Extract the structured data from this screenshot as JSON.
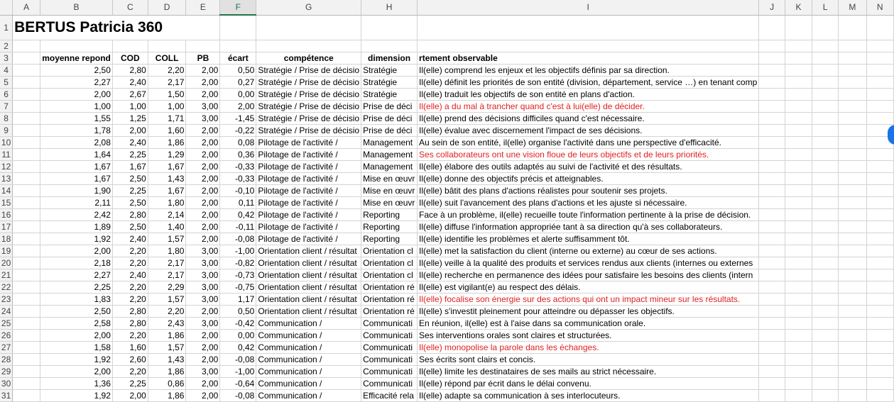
{
  "columns": [
    "A",
    "B",
    "C",
    "D",
    "E",
    "F",
    "G",
    "H",
    "I",
    "J",
    "K",
    "L",
    "M",
    "N"
  ],
  "selected_column": "F",
  "title": "BERTUS  Patricia 360",
  "headers": {
    "b": "moyenne repond",
    "c": "COD",
    "d": "COLL",
    "e": "PB",
    "f": "écart",
    "g": "compétence",
    "h": "dimension",
    "i": "rtement observable"
  },
  "rows": [
    {
      "n": "4",
      "b": "2,50",
      "c": "2,80",
      "d": "2,20",
      "e": "2,00",
      "f": "0,50",
      "g": "Stratégie / Prise de décisio",
      "h": "Stratégie",
      "i": "Il(elle) comprend les enjeux et les objectifs définis par sa direction.",
      "red": false
    },
    {
      "n": "5",
      "b": "2,27",
      "c": "2,40",
      "d": "2,17",
      "e": "2,00",
      "f": "0,27",
      "g": "Stratégie / Prise de décisio",
      "h": "Stratégie",
      "i": "Il(elle) définit les priorités de son entité (division, département, service …) en tenant comp",
      "red": false
    },
    {
      "n": "6",
      "b": "2,00",
      "c": "2,67",
      "d": "1,50",
      "e": "2,00",
      "f": "0,00",
      "g": "Stratégie / Prise de décisio",
      "h": "Stratégie",
      "i": "Il(elle) traduit les objectifs de son entité en plans d'action.",
      "red": false
    },
    {
      "n": "7",
      "b": "1,00",
      "c": "1,00",
      "d": "1,00",
      "e": "3,00",
      "f": "2,00",
      "g": "Stratégie / Prise de décisio",
      "h": "Prise de déci",
      "i": "Il(elle) a du mal à trancher quand c'est à lui(elle) de décider.",
      "red": true
    },
    {
      "n": "8",
      "b": "1,55",
      "c": "1,25",
      "d": "1,71",
      "e": "3,00",
      "f": "-1,45",
      "g": "Stratégie / Prise de décisio",
      "h": "Prise de déci",
      "i": "Il(elle) prend des décisions difficiles quand c'est nécessaire.",
      "red": false
    },
    {
      "n": "9",
      "b": "1,78",
      "c": "2,00",
      "d": "1,60",
      "e": "2,00",
      "f": "-0,22",
      "g": "Stratégie / Prise de décisio",
      "h": "Prise de déci",
      "i": "Il(elle) évalue avec discernement l'impact de ses décisions.",
      "red": false
    },
    {
      "n": "10",
      "b": "2,08",
      "c": "2,40",
      "d": "1,86",
      "e": "2,00",
      "f": "0,08",
      "g": "Pilotage de l'activité /",
      "h": "Management",
      "i": "Au sein de son entité, il(elle) organise l'activité dans une perspective d'efficacité.",
      "red": false
    },
    {
      "n": "11",
      "b": "1,64",
      "c": "2,25",
      "d": "1,29",
      "e": "2,00",
      "f": "0,36",
      "g": "Pilotage de l'activité /",
      "h": "Management",
      "i": "Ses collaborateurs ont une vision floue de leurs objectifs et de leurs priorités.",
      "red": true
    },
    {
      "n": "12",
      "b": "1,67",
      "c": "1,67",
      "d": "1,67",
      "e": "2,00",
      "f": "-0,33",
      "g": "Pilotage de l'activité /",
      "h": "Management",
      "i": "Il(elle) élabore des outils adaptés au suivi de l'activité et des résultats.",
      "red": false
    },
    {
      "n": "13",
      "b": "1,67",
      "c": "2,50",
      "d": "1,43",
      "e": "2,00",
      "f": "-0,33",
      "g": "Pilotage de l'activité /",
      "h": "Mise en œuvr",
      "i": "Il(elle) donne des objectifs précis et atteignables.",
      "red": false
    },
    {
      "n": "14",
      "b": "1,90",
      "c": "2,25",
      "d": "1,67",
      "e": "2,00",
      "f": "-0,10",
      "g": "Pilotage de l'activité /",
      "h": "Mise en œuvr",
      "i": "Il(elle) bâtit des plans d'actions réalistes pour soutenir ses projets.",
      "red": false
    },
    {
      "n": "15",
      "b": "2,11",
      "c": "2,50",
      "d": "1,80",
      "e": "2,00",
      "f": "0,11",
      "g": "Pilotage de l'activité /",
      "h": "Mise en œuvr",
      "i": "Il(elle) suit l'avancement des plans d'actions et les ajuste si nécessaire.",
      "red": false
    },
    {
      "n": "16",
      "b": "2,42",
      "c": "2,80",
      "d": "2,14",
      "e": "2,00",
      "f": "0,42",
      "g": "Pilotage de l'activité /",
      "h": "Reporting",
      "i": "Face à un problème, il(elle) recueille toute l'information pertinente à la prise de décision.",
      "red": false
    },
    {
      "n": "17",
      "b": "1,89",
      "c": "2,50",
      "d": "1,40",
      "e": "2,00",
      "f": "-0,11",
      "g": "Pilotage de l'activité /",
      "h": "Reporting",
      "i": "Il(elle) diffuse l'information appropriée tant à sa direction qu'à ses collaborateurs.",
      "red": false
    },
    {
      "n": "18",
      "b": "1,92",
      "c": "2,40",
      "d": "1,57",
      "e": "2,00",
      "f": "-0,08",
      "g": "Pilotage de l'activité /",
      "h": "Reporting",
      "i": "Il(elle) identifie les problèmes et alerte suffisamment tôt.",
      "red": false
    },
    {
      "n": "19",
      "b": "2,00",
      "c": "2,20",
      "d": "1,80",
      "e": "3,00",
      "f": "-1,00",
      "g": "Orientation client / résultat",
      "h": "Orientation cl",
      "i": "Il(elle) met la satisfaction du client (interne ou externe) au cœur de ses actions.",
      "red": false
    },
    {
      "n": "20",
      "b": "2,18",
      "c": "2,20",
      "d": "2,17",
      "e": "3,00",
      "f": "-0,82",
      "g": "Orientation client / résultat",
      "h": "Orientation cl",
      "i": "Il(elle) veille à la qualité des produits et services rendus aux clients (internes ou externes",
      "red": false
    },
    {
      "n": "21",
      "b": "2,27",
      "c": "2,40",
      "d": "2,17",
      "e": "3,00",
      "f": "-0,73",
      "g": "Orientation client / résultat",
      "h": "Orientation cl",
      "i": "Il(elle) recherche en permanence des idées pour satisfaire les besoins des clients (intern",
      "red": false
    },
    {
      "n": "22",
      "b": "2,25",
      "c": "2,20",
      "d": "2,29",
      "e": "3,00",
      "f": "-0,75",
      "g": "Orientation client / résultat",
      "h": "Orientation ré",
      "i": "Il(elle) est vigilant(e) au respect des délais.",
      "red": false
    },
    {
      "n": "23",
      "b": "1,83",
      "c": "2,20",
      "d": "1,57",
      "e": "3,00",
      "f": "1,17",
      "g": "Orientation client / résultat",
      "h": "Orientation ré",
      "i": "Il(elle) focalise son énergie sur des actions qui ont un impact mineur sur les résultats.",
      "red": true
    },
    {
      "n": "24",
      "b": "2,50",
      "c": "2,80",
      "d": "2,20",
      "e": "2,00",
      "f": "0,50",
      "g": "Orientation client / résultat",
      "h": "Orientation ré",
      "i": "Il(elle) s'investit pleinement pour atteindre ou dépasser les objectifs.",
      "red": false
    },
    {
      "n": "25",
      "b": "2,58",
      "c": "2,80",
      "d": "2,43",
      "e": "3,00",
      "f": "-0,42",
      "g": "Communication /",
      "h": "Communicati",
      "i": "En réunion, il(elle) est à l'aise dans sa communication orale.",
      "red": false
    },
    {
      "n": "26",
      "b": "2,00",
      "c": "2,20",
      "d": "1,86",
      "e": "2,00",
      "f": "0,00",
      "g": "Communication /",
      "h": "Communicati",
      "i": "Ses interventions orales sont claires et structurées.",
      "red": false
    },
    {
      "n": "27",
      "b": "1,58",
      "c": "1,60",
      "d": "1,57",
      "e": "2,00",
      "f": "0,42",
      "g": "Communication /",
      "h": "Communicati",
      "i": "Il(elle) monopolise la parole dans les échanges.",
      "red": true
    },
    {
      "n": "28",
      "b": "1,92",
      "c": "2,60",
      "d": "1,43",
      "e": "2,00",
      "f": "-0,08",
      "g": "Communication /",
      "h": "Communicati",
      "i": "Ses écrits sont clairs et concis.",
      "red": false
    },
    {
      "n": "29",
      "b": "2,00",
      "c": "2,20",
      "d": "1,86",
      "e": "3,00",
      "f": "-1,00",
      "g": "Communication /",
      "h": "Communicati",
      "i": "Il(elle) limite les destinataires de ses mails au strict nécessaire.",
      "red": false
    },
    {
      "n": "30",
      "b": "1,36",
      "c": "2,25",
      "d": "0,86",
      "e": "2,00",
      "f": "-0,64",
      "g": "Communication /",
      "h": "Communicati",
      "i": "Il(elle) répond par écrit dans le délai convenu.",
      "red": false
    },
    {
      "n": "31",
      "b": "1,92",
      "c": "2,00",
      "d": "1,86",
      "e": "2,00",
      "f": "-0,08",
      "g": "Communication /",
      "h": "Efficacité rela",
      "i": "Il(elle) adapte sa communication à ses interlocuteurs.",
      "red": false
    }
  ]
}
